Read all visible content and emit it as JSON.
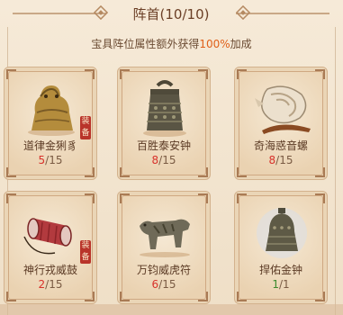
{
  "header": {
    "title": "阵首(10/10)",
    "subtitle_prefix": "宝具阵位属性额外获得",
    "subtitle_pct": "100%",
    "subtitle_suffix": "加成"
  },
  "treasures": [
    {
      "name": "道律金猁豸",
      "current": "5",
      "max": "/15",
      "tag": "装备",
      "icon": "golden-beast-statue-icon"
    },
    {
      "name": "百胜泰安钟",
      "current": "8",
      "max": "/15",
      "icon": "bronze-bell-icon"
    },
    {
      "name": "奇海惑音螺",
      "current": "8",
      "max": "/15",
      "icon": "conch-shell-icon"
    },
    {
      "name": "神行戎威鼓",
      "current": "2",
      "max": "/15",
      "tag": "装备",
      "icon": "red-drum-icon"
    },
    {
      "name": "万钧威虎符",
      "current": "6",
      "max": "/15",
      "icon": "tiger-tally-icon"
    },
    {
      "name": "捍佑金钟",
      "current": "1",
      "max": "/1",
      "icon": "golden-bell-icon"
    }
  ],
  "colors": {
    "level_incomplete": "#d8322b",
    "level_complete": "#3c8a2e",
    "highlight": "#e0601a"
  }
}
